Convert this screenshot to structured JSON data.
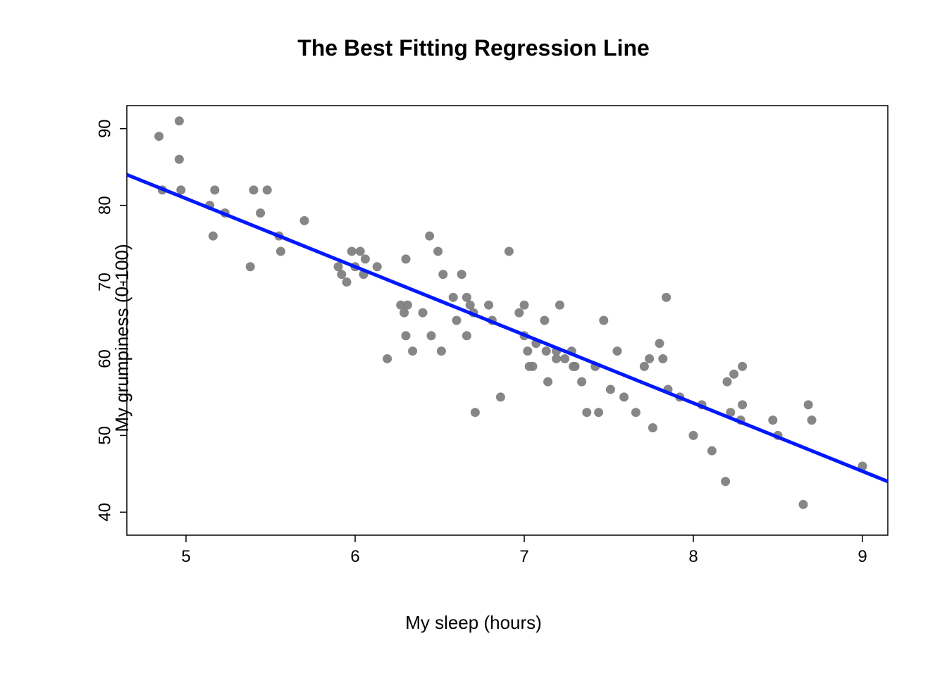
{
  "chart_data": {
    "type": "scatter",
    "title": "The Best Fitting Regression Line",
    "xlabel": "My sleep (hours)",
    "ylabel": "My grumpiness (0-100)",
    "xlim": [
      4.65,
      9.15
    ],
    "ylim": [
      37,
      93
    ],
    "xticks": [
      5,
      6,
      7,
      8,
      9
    ],
    "yticks": [
      40,
      50,
      60,
      70,
      80,
      90
    ],
    "regression_line": {
      "x1": 4.65,
      "y1": 84.0,
      "x2": 9.15,
      "y2": 44.0,
      "color": "#0018FF"
    },
    "point_color": "#808080",
    "points": [
      [
        4.84,
        89
      ],
      [
        4.86,
        82
      ],
      [
        4.96,
        91
      ],
      [
        4.96,
        86
      ],
      [
        4.97,
        82
      ],
      [
        5.14,
        80
      ],
      [
        5.16,
        76
      ],
      [
        5.17,
        82
      ],
      [
        5.23,
        79
      ],
      [
        5.38,
        72
      ],
      [
        5.4,
        82
      ],
      [
        5.44,
        79
      ],
      [
        5.48,
        82
      ],
      [
        5.55,
        76
      ],
      [
        5.56,
        74
      ],
      [
        5.7,
        78
      ],
      [
        5.9,
        72
      ],
      [
        5.92,
        71
      ],
      [
        5.95,
        70
      ],
      [
        5.98,
        74
      ],
      [
        6.0,
        72
      ],
      [
        6.03,
        74
      ],
      [
        6.05,
        71
      ],
      [
        6.06,
        73
      ],
      [
        6.13,
        72
      ],
      [
        6.19,
        60
      ],
      [
        6.27,
        67
      ],
      [
        6.29,
        66
      ],
      [
        6.3,
        73
      ],
      [
        6.3,
        63
      ],
      [
        6.31,
        67
      ],
      [
        6.34,
        61
      ],
      [
        6.4,
        66
      ],
      [
        6.44,
        76
      ],
      [
        6.45,
        63
      ],
      [
        6.49,
        74
      ],
      [
        6.51,
        61
      ],
      [
        6.52,
        71
      ],
      [
        6.58,
        68
      ],
      [
        6.6,
        65
      ],
      [
        6.63,
        71
      ],
      [
        6.66,
        63
      ],
      [
        6.66,
        68
      ],
      [
        6.68,
        67
      ],
      [
        6.7,
        66
      ],
      [
        6.71,
        53
      ],
      [
        6.79,
        67
      ],
      [
        6.81,
        65
      ],
      [
        6.86,
        55
      ],
      [
        6.91,
        74
      ],
      [
        6.97,
        66
      ],
      [
        7.0,
        63
      ],
      [
        7.0,
        67
      ],
      [
        7.02,
        61
      ],
      [
        7.03,
        59
      ],
      [
        7.05,
        59
      ],
      [
        7.07,
        62
      ],
      [
        7.12,
        65
      ],
      [
        7.13,
        61
      ],
      [
        7.14,
        57
      ],
      [
        7.19,
        61
      ],
      [
        7.19,
        60
      ],
      [
        7.21,
        67
      ],
      [
        7.24,
        60
      ],
      [
        7.28,
        61
      ],
      [
        7.29,
        59
      ],
      [
        7.3,
        59
      ],
      [
        7.34,
        57
      ],
      [
        7.37,
        53
      ],
      [
        7.42,
        59
      ],
      [
        7.44,
        53
      ],
      [
        7.47,
        65
      ],
      [
        7.51,
        56
      ],
      [
        7.55,
        61
      ],
      [
        7.59,
        55
      ],
      [
        7.66,
        53
      ],
      [
        7.71,
        59
      ],
      [
        7.74,
        60
      ],
      [
        7.76,
        51
      ],
      [
        7.8,
        62
      ],
      [
        7.82,
        60
      ],
      [
        7.84,
        68
      ],
      [
        7.85,
        56
      ],
      [
        7.92,
        55
      ],
      [
        8.0,
        50
      ],
      [
        8.05,
        54
      ],
      [
        8.11,
        48
      ],
      [
        8.19,
        44
      ],
      [
        8.2,
        57
      ],
      [
        8.22,
        53
      ],
      [
        8.24,
        58
      ],
      [
        8.28,
        52
      ],
      [
        8.29,
        54
      ],
      [
        8.29,
        59
      ],
      [
        8.47,
        52
      ],
      [
        8.5,
        50
      ],
      [
        8.65,
        41
      ],
      [
        8.68,
        54
      ],
      [
        8.7,
        52
      ],
      [
        9.0,
        46
      ]
    ]
  }
}
